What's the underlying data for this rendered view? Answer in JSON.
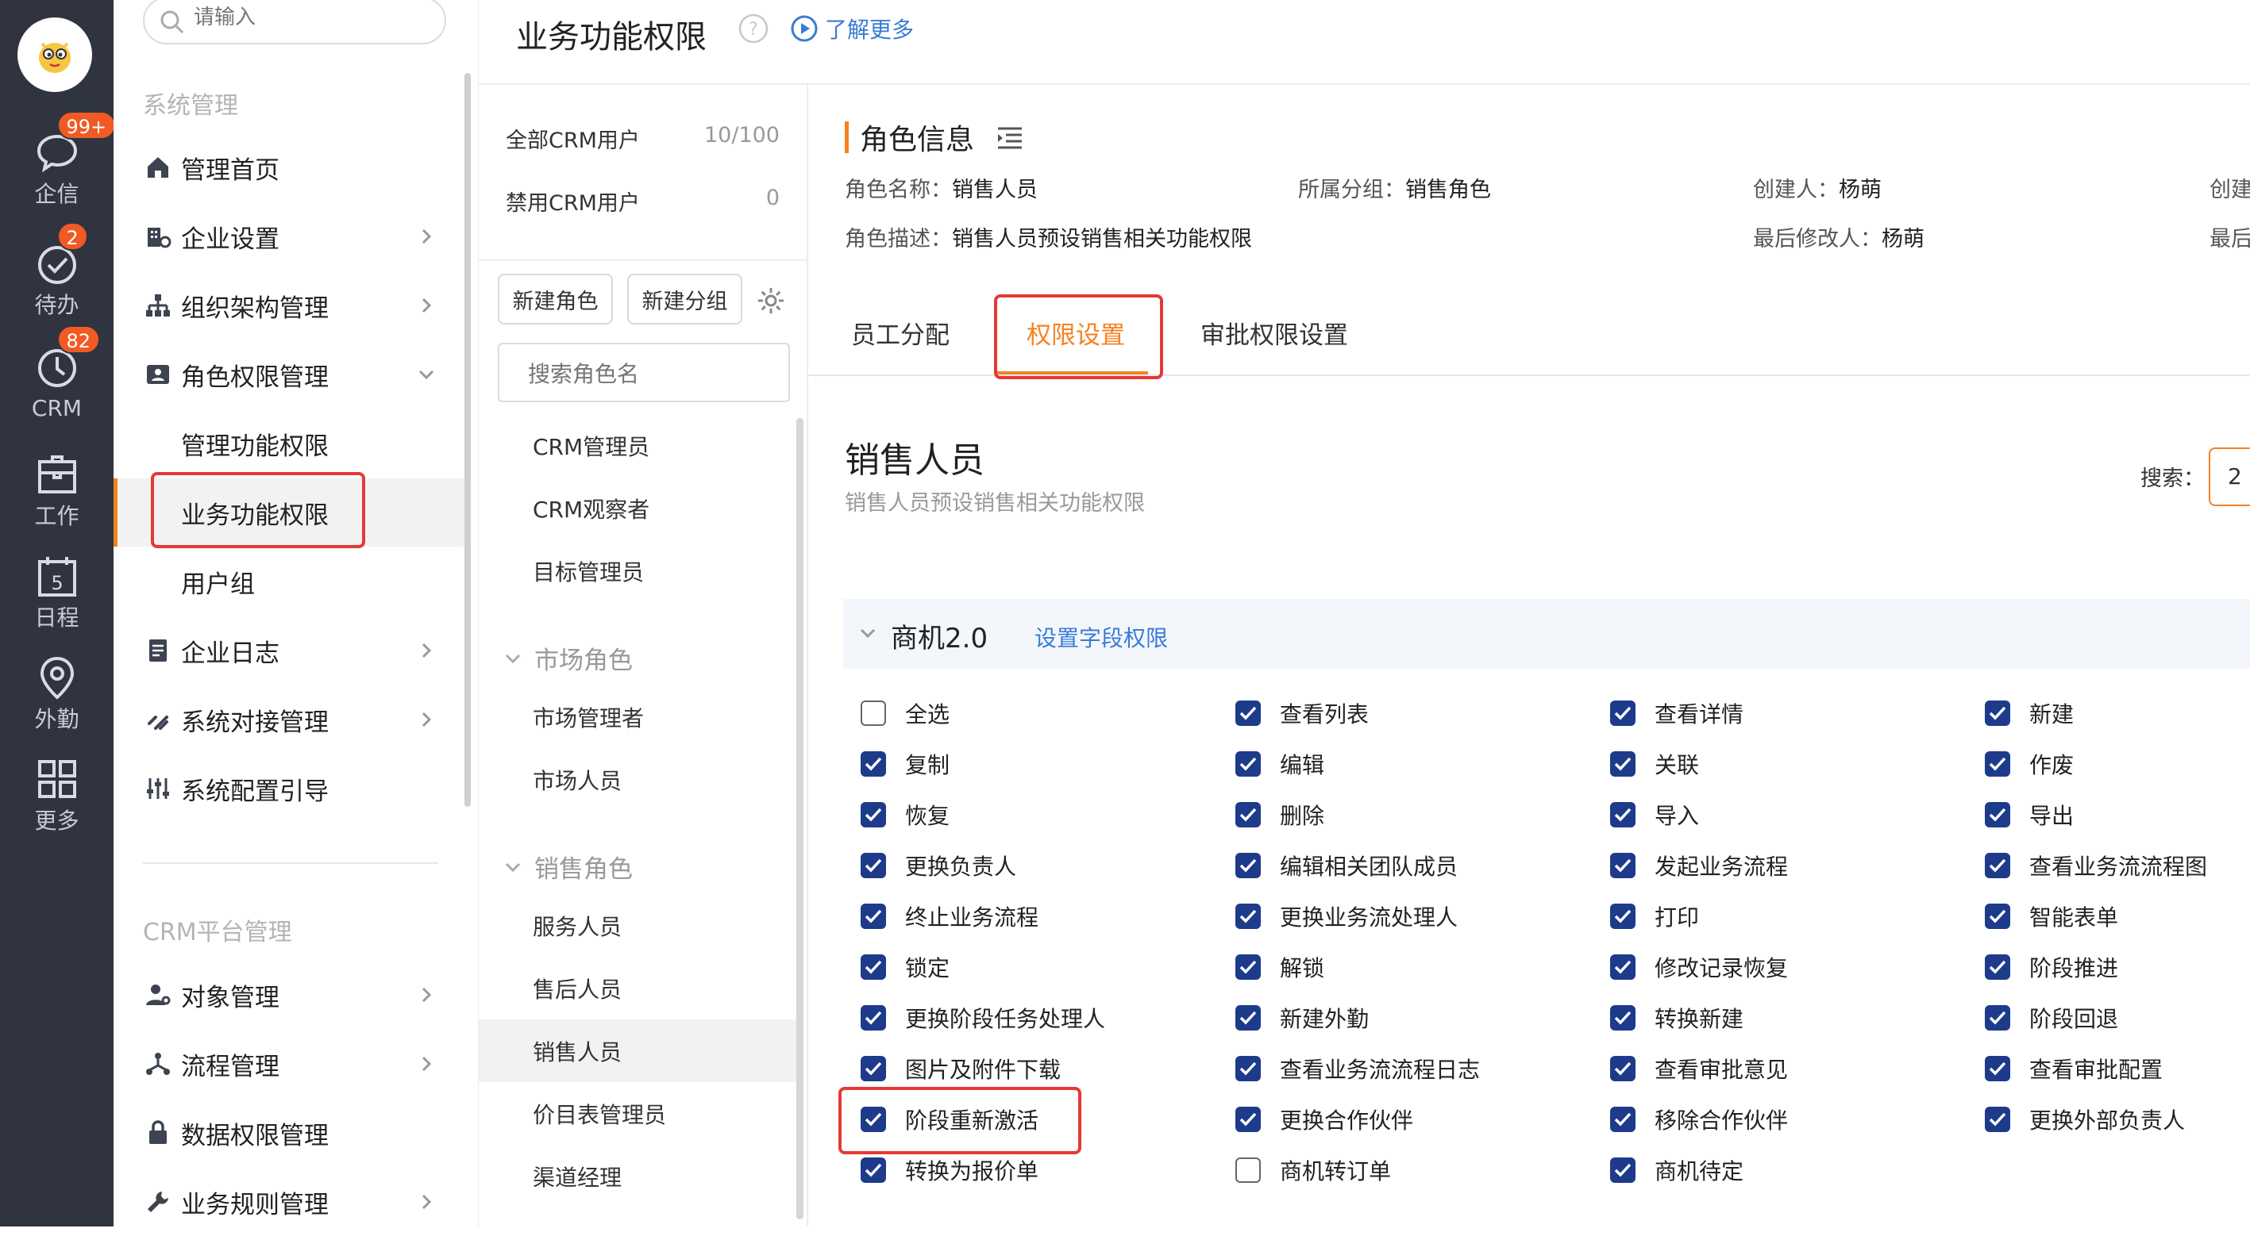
{
  "rail": {
    "items": [
      {
        "label": "企信",
        "icon": "chat-bubble-icon",
        "badge": "99+"
      },
      {
        "label": "待办",
        "icon": "check-circle-icon",
        "badge": "2"
      },
      {
        "label": "CRM",
        "icon": "clock-icon",
        "badge": "82"
      },
      {
        "label": "工作",
        "icon": "briefcase-icon",
        "badge": ""
      },
      {
        "label": "日程",
        "icon": "calendar-icon",
        "badge": "",
        "day": "5"
      },
      {
        "label": "外勤",
        "icon": "location-pin-icon",
        "badge": ""
      },
      {
        "label": "更多",
        "icon": "grid-icon",
        "badge": ""
      }
    ]
  },
  "sidebar": {
    "search_placeholder": "请输入",
    "section_system": "系统管理",
    "section_crm": "CRM平台管理",
    "items": {
      "home": "管理首页",
      "company": "企业设置",
      "org": "组织架构管理",
      "role": "角色权限管理",
      "mgmt_perm": "管理功能权限",
      "biz_perm": "业务功能权限",
      "user_group": "用户组",
      "log": "企业日志",
      "integration": "系统对接管理",
      "guide": "系统配置引导",
      "object": "对象管理",
      "flow": "流程管理",
      "data_perm": "数据权限管理",
      "biz_rules": "业务规则管理"
    }
  },
  "header": {
    "title": "业务功能权限",
    "learn_more": "了解更多"
  },
  "role_panel": {
    "all_users_label": "全部CRM用户",
    "all_users_count": "10/100",
    "disabled_users_label": "禁用CRM用户",
    "disabled_users_count": "0",
    "new_role": "新建角色",
    "new_group": "新建分组",
    "search_placeholder": "搜索角色名",
    "ungrouped": [
      "CRM管理员",
      "CRM观察者",
      "目标管理员"
    ],
    "market_group": "市场角色",
    "market_roles": [
      "市场管理者",
      "市场人员"
    ],
    "sales_group": "销售角色",
    "sales_roles": [
      "服务人员",
      "售后人员",
      "销售人员",
      "价目表管理员",
      "渠道经理"
    ]
  },
  "role_info": {
    "heading": "角色信息",
    "name_label": "角色名称：",
    "name_value": "销售人员",
    "group_label": "所属分组：",
    "group_value": "销售角色",
    "creator_label": "创建人：",
    "creator_value": "杨萌",
    "extra_top": "创建",
    "desc_label": "角色描述：",
    "desc_value": "销售人员预设销售相关功能权限",
    "modifier_label": "最后修改人：",
    "modifier_value": "杨萌",
    "extra_bottom": "最后"
  },
  "tabs": [
    "员工分配",
    "权限设置",
    "审批权限设置"
  ],
  "content": {
    "role_title": "销售人员",
    "role_desc": "销售人员预设销售相关功能权限",
    "search_label": "搜索：",
    "search_value": "2",
    "module_name": "商机2.0",
    "module_link": "设置字段权限",
    "permissions": [
      [
        "全选",
        false
      ],
      [
        "查看列表",
        true
      ],
      [
        "查看详情",
        true
      ],
      [
        "新建",
        true
      ],
      [
        "复制",
        true
      ],
      [
        "编辑",
        true
      ],
      [
        "关联",
        true
      ],
      [
        "作废",
        true
      ],
      [
        "恢复",
        true
      ],
      [
        "删除",
        true
      ],
      [
        "导入",
        true
      ],
      [
        "导出",
        true
      ],
      [
        "更换负责人",
        true
      ],
      [
        "编辑相关团队成员",
        true
      ],
      [
        "发起业务流程",
        true
      ],
      [
        "查看业务流流程图",
        true
      ],
      [
        "终止业务流程",
        true
      ],
      [
        "更换业务流处理人",
        true
      ],
      [
        "打印",
        true
      ],
      [
        "智能表单",
        true
      ],
      [
        "锁定",
        true
      ],
      [
        "解锁",
        true
      ],
      [
        "修改记录恢复",
        true
      ],
      [
        "阶段推进",
        true
      ],
      [
        "更换阶段任务处理人",
        true
      ],
      [
        "新建外勤",
        true
      ],
      [
        "转换新建",
        true
      ],
      [
        "阶段回退",
        true
      ],
      [
        "图片及附件下载",
        true
      ],
      [
        "查看业务流流程日志",
        true
      ],
      [
        "查看审批意见",
        true
      ],
      [
        "查看审批配置",
        true
      ],
      [
        "阶段重新激活",
        true
      ],
      [
        "更换合作伙伴",
        true
      ],
      [
        "移除合作伙伴",
        true
      ],
      [
        "更换外部负责人",
        true
      ],
      [
        "转换为报价单",
        true
      ],
      [
        "商机转订单",
        false
      ],
      [
        "商机待定",
        true
      ]
    ]
  },
  "colors": {
    "rail_bg": "#2f3440",
    "accent": "#f58220",
    "link": "#3a7bd5",
    "checkbox": "#1d3b8a",
    "highlight_box": "#e53935"
  }
}
